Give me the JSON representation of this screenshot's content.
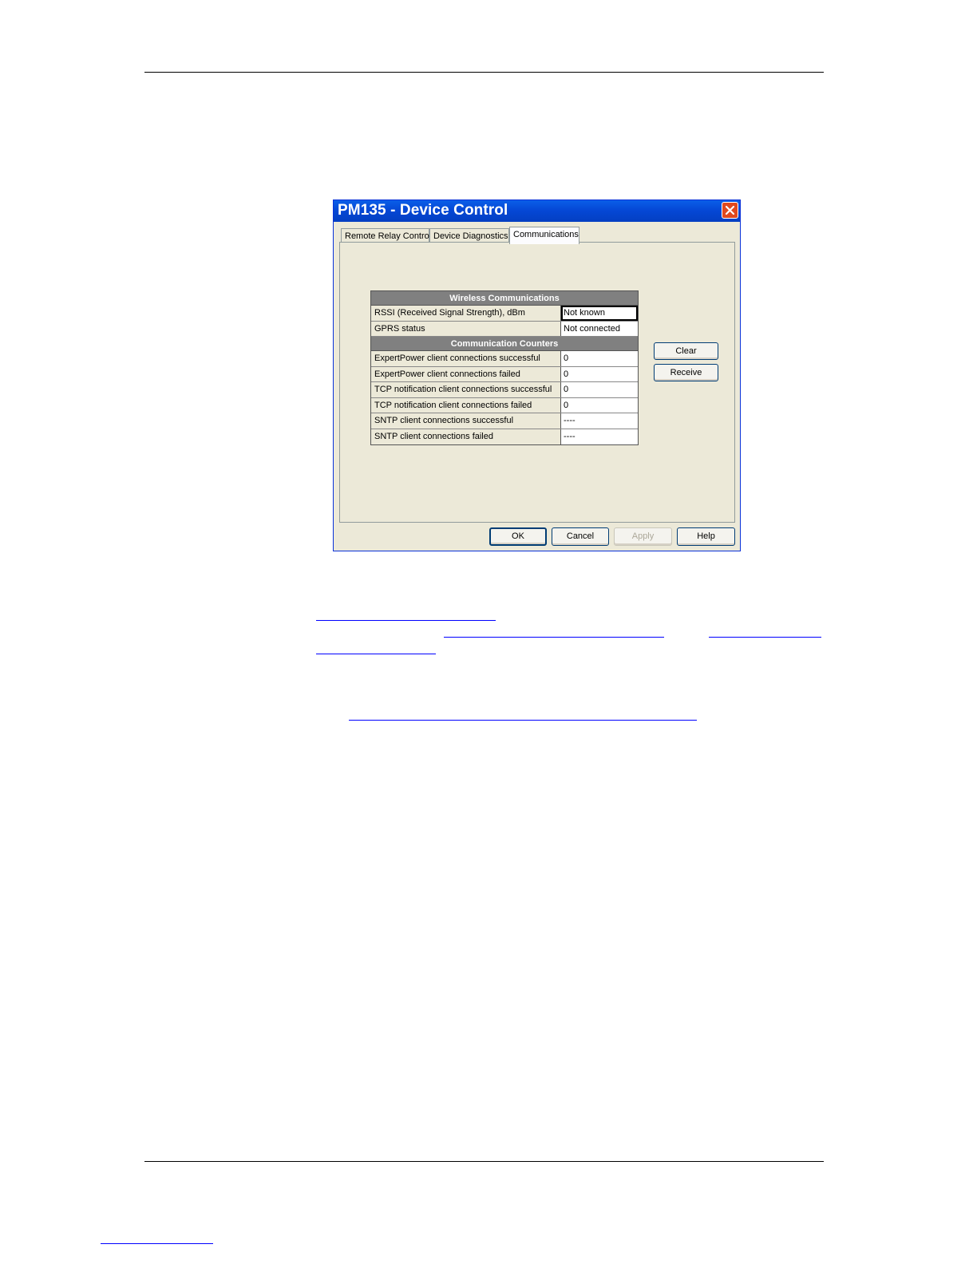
{
  "dialog": {
    "title": "PM135 - Device Control",
    "close_icon": "close-icon",
    "tabs": [
      {
        "label": "Remote Relay Control"
      },
      {
        "label": "Device Diagnostics"
      },
      {
        "label": "Communications",
        "active": true
      }
    ],
    "wireless": {
      "header": "Wireless Communications",
      "rows": [
        {
          "label": "RSSI (Received Signal Strength), dBm",
          "value": "Not known"
        },
        {
          "label": "GPRS status",
          "value": "Not connected"
        }
      ]
    },
    "counters": {
      "header": "Communication Counters",
      "rows": [
        {
          "label": "ExpertPower client connections successful",
          "value": "0"
        },
        {
          "label": "ExpertPower client connections failed",
          "value": "0"
        },
        {
          "label": "TCP notification client connections successful",
          "value": "0"
        },
        {
          "label": "TCP notification client connections failed",
          "value": "0"
        },
        {
          "label": "SNTP client connections successful",
          "value": "----"
        },
        {
          "label": "SNTP client connections failed",
          "value": "----"
        }
      ]
    },
    "side_buttons": {
      "clear": "Clear",
      "receive": "Receive"
    },
    "footer_buttons": {
      "ok": "OK",
      "cancel": "Cancel",
      "apply": "Apply",
      "help": "Help"
    }
  },
  "colors": {
    "title_bar": "#0548d6",
    "dialog_bg": "#ece9d8",
    "link": "#0000ff"
  }
}
